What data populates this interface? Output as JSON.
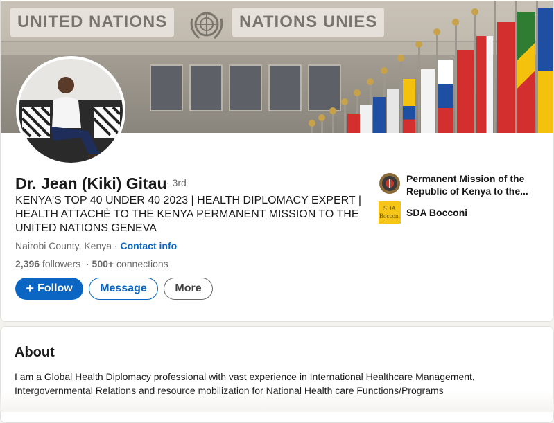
{
  "banner": {
    "sign_left": "UNITED NATIONS",
    "sign_right": "NATIONS UNIES"
  },
  "profile": {
    "name": "Dr. Jean (Kiki) Gitau",
    "degree": "· 3rd",
    "headline": "KENYA'S TOP 40 UNDER 40 2023 | HEALTH DIPLOMACY EXPERT | HEALTH ATTACHÈ TO THE KENYA PERMANENT MISSION TO THE UNITED NATIONS GENEVA",
    "location": "Nairobi County, Kenya",
    "location_sep": " · ",
    "contact_label": "Contact info",
    "followers_count": "2,396",
    "followers_label": " followers",
    "stats_sep": "  · ",
    "connections_count": "500+",
    "connections_label": " connections"
  },
  "actions": {
    "follow_label": "Follow",
    "message_label": "Message",
    "more_label": "More"
  },
  "orgs": [
    {
      "name": "Permanent Mission of the Republic of Kenya to the...",
      "icon": "kenya-coat-of-arms-icon"
    },
    {
      "name": "SDA Bocconi",
      "icon": "sda-bocconi-logo",
      "logo_text": "SDA Bocconi"
    }
  ],
  "about": {
    "title": "About",
    "text": "I am a Global Health Diplomacy professional with vast experience in International Healthcare Management, Intergovernmental Relations and resource mobilization for National Health care Functions/Programs"
  },
  "colors": {
    "brand_blue": "#0a66c2",
    "sda_yellow": "#f5c518"
  }
}
